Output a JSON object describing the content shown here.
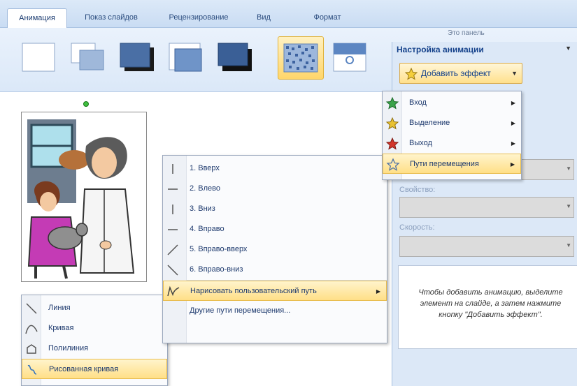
{
  "ribbon": {
    "tabs": [
      "Анимация",
      "Показ слайдов",
      "Рецензирование",
      "Вид",
      "Формат"
    ]
  },
  "transitions": [
    "blank",
    "fade",
    "shadow",
    "cover",
    "push",
    "dissolve",
    "wipe"
  ],
  "task_pane": {
    "title": "Настройка анимации",
    "add_effect_label": "Добавить эффект",
    "property_label": "Свойство:",
    "speed_label": "Скорость:",
    "hint": "Чтобы добавить анимацию, выделите элемент на слайде, а затем нажмите кнопку \"Добавить эффект\".",
    "top_tail_text": "Это панель"
  },
  "effect_menu": {
    "items": [
      {
        "label": "Вход",
        "icon": "green-star-icon",
        "submenu": true
      },
      {
        "label": "Выделение",
        "icon": "yellow-star-icon",
        "submenu": true
      },
      {
        "label": "Выход",
        "icon": "red-star-icon",
        "submenu": true
      },
      {
        "label": "Пути перемещения",
        "icon": "outline-star-icon",
        "submenu": true,
        "highlighted": true
      }
    ]
  },
  "paths_menu": {
    "items": [
      {
        "label": "1. Вверх",
        "icon": "line-up-icon"
      },
      {
        "label": "2. Влево",
        "icon": "line-left-icon"
      },
      {
        "label": "3. Вниз",
        "icon": "line-down-icon"
      },
      {
        "label": "4. Вправо",
        "icon": "line-right-icon"
      },
      {
        "label": "5. Вправо-вверх",
        "icon": "line-up-right-icon"
      },
      {
        "label": "6. Вправо-вниз",
        "icon": "line-down-right-icon"
      },
      {
        "label": "Нарисовать пользовательский путь",
        "icon": "freeform-path-icon",
        "submenu": true,
        "highlighted": true
      },
      {
        "label": "Другие пути перемещения...",
        "icon": ""
      }
    ]
  },
  "draw_menu": {
    "items": [
      {
        "label": "Линия",
        "icon": "line-icon"
      },
      {
        "label": "Кривая",
        "icon": "curve-icon"
      },
      {
        "label": "Полилиния",
        "icon": "polyline-icon"
      },
      {
        "label": "Рисованная кривая",
        "icon": "scribble-icon",
        "highlighted": true
      }
    ]
  },
  "colors": {
    "highlight": "#ffdf87",
    "ribbon": "#dbe8f8",
    "pane": "#dce8f7",
    "title": "#15428b"
  }
}
